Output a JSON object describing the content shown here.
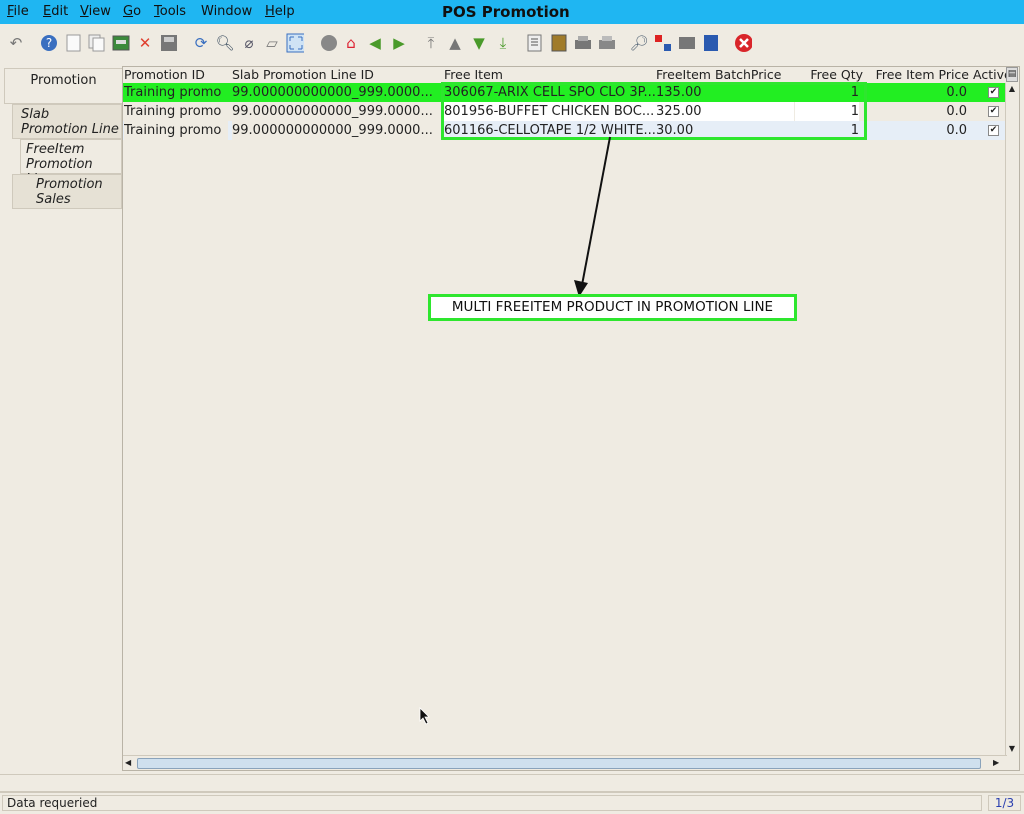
{
  "window": {
    "title": "POS Promotion"
  },
  "menu": [
    {
      "label": "File",
      "u": "F",
      "rest": "ile"
    },
    {
      "label": "Edit",
      "u": "E",
      "rest": "dit"
    },
    {
      "label": "View",
      "u": "V",
      "rest": "iew"
    },
    {
      "label": "Go",
      "u": "G",
      "rest": "o"
    },
    {
      "label": "Tools",
      "u": "T",
      "rest": "ools"
    },
    {
      "label": "Window",
      "u": "",
      "rest": "Window"
    },
    {
      "label": "Help",
      "u": "H",
      "rest": "elp"
    }
  ],
  "tabs": [
    {
      "label": "Promotion"
    },
    {
      "label_line1": "Slab",
      "label_line2": "Promotion Line"
    },
    {
      "label_line1": "FreeItem",
      "label_line2": "Promotion Line"
    },
    {
      "label_line1": "Promotion",
      "label_line2": "Sales"
    }
  ],
  "grid": {
    "columns": [
      "Promotion ID",
      "Slab Promotion Line ID",
      "Free Item",
      "FreeItem BatchPrice",
      "Free Qty",
      "Free Item Price",
      "Active"
    ],
    "rows": [
      {
        "promotion_id": "Training promo",
        "slab_line": "99.000000000000_999.0000...",
        "free_item": "306067-ARIX CELL SPO CLO 3P...",
        "batch_price": "135.00",
        "free_qty": "1",
        "item_price": "0.0",
        "active": "✔"
      },
      {
        "promotion_id": "Training promo",
        "slab_line": "99.000000000000_999.0000...",
        "free_item": "801956-BUFFET CHICKEN BOC...",
        "batch_price": "325.00",
        "free_qty": "1",
        "item_price": "0.0",
        "active": "✔"
      },
      {
        "promotion_id": "Training promo",
        "slab_line": "99.000000000000_999.0000...",
        "free_item": "601166-CELLOTAPE 1/2 WHITE...",
        "batch_price": "30.00",
        "free_qty": "1",
        "item_price": "0.0",
        "active": "✔"
      }
    ]
  },
  "annotation": {
    "text": "MULTI FREEITEM PRODUCT IN PROMOTION LINE"
  },
  "status": {
    "message": "Data requeried",
    "record": "1/3"
  },
  "colors": {
    "titlebar": "#1fb6f2",
    "highlight": "#2ee62e",
    "selected_row": "#22ee22"
  }
}
